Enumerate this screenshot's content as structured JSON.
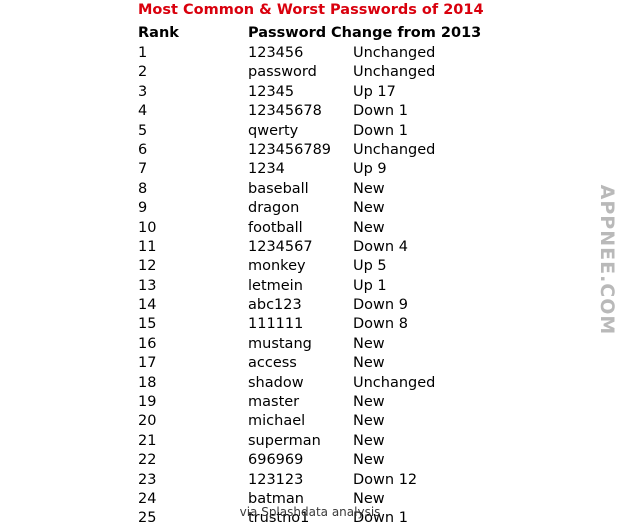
{
  "title": "Most Common & Worst Passwords of 2014",
  "columns": {
    "rank": "Rank",
    "password": "Password",
    "change": "Change from 2013"
  },
  "rows": [
    {
      "rank": "1",
      "password": "123456",
      "change": "Unchanged"
    },
    {
      "rank": "2",
      "password": "password",
      "change": "Unchanged"
    },
    {
      "rank": "3",
      "password": "12345",
      "change": "Up 17"
    },
    {
      "rank": "4",
      "password": "12345678",
      "change": "Down 1"
    },
    {
      "rank": "5",
      "password": "qwerty",
      "change": "Down 1"
    },
    {
      "rank": "6",
      "password": "123456789",
      "change": "Unchanged"
    },
    {
      "rank": "7",
      "password": "1234",
      "change": "Up 9"
    },
    {
      "rank": "8",
      "password": "baseball",
      "change": "New"
    },
    {
      "rank": "9",
      "password": "dragon",
      "change": "New"
    },
    {
      "rank": "10",
      "password": "football",
      "change": "New"
    },
    {
      "rank": "11",
      "password": "1234567",
      "change": "Down 4"
    },
    {
      "rank": "12",
      "password": "monkey",
      "change": "Up 5"
    },
    {
      "rank": "13",
      "password": "letmein",
      "change": "Up 1"
    },
    {
      "rank": "14",
      "password": "abc123",
      "change": "Down 9"
    },
    {
      "rank": "15",
      "password": "111111",
      "change": "Down 8"
    },
    {
      "rank": "16",
      "password": "mustang",
      "change": "New"
    },
    {
      "rank": "17",
      "password": "access",
      "change": "New"
    },
    {
      "rank": "18",
      "password": "shadow",
      "change": "Unchanged"
    },
    {
      "rank": "19",
      "password": "master",
      "change": "New"
    },
    {
      "rank": "20",
      "password": "michael",
      "change": "New"
    },
    {
      "rank": "21",
      "password": "superman",
      "change": "New"
    },
    {
      "rank": "22",
      "password": "696969",
      "change": "New"
    },
    {
      "rank": "23",
      "password": "123123",
      "change": "Down 12"
    },
    {
      "rank": "24",
      "password": "batman",
      "change": "New"
    },
    {
      "rank": "25",
      "password": "trustno1",
      "change": "Down 1"
    }
  ],
  "footer": "via Splashdata analysis",
  "watermark": "APPNEE.COM",
  "colors": {
    "title": "#d9000d",
    "text": "#000000",
    "watermark": "#b9b9b9"
  }
}
